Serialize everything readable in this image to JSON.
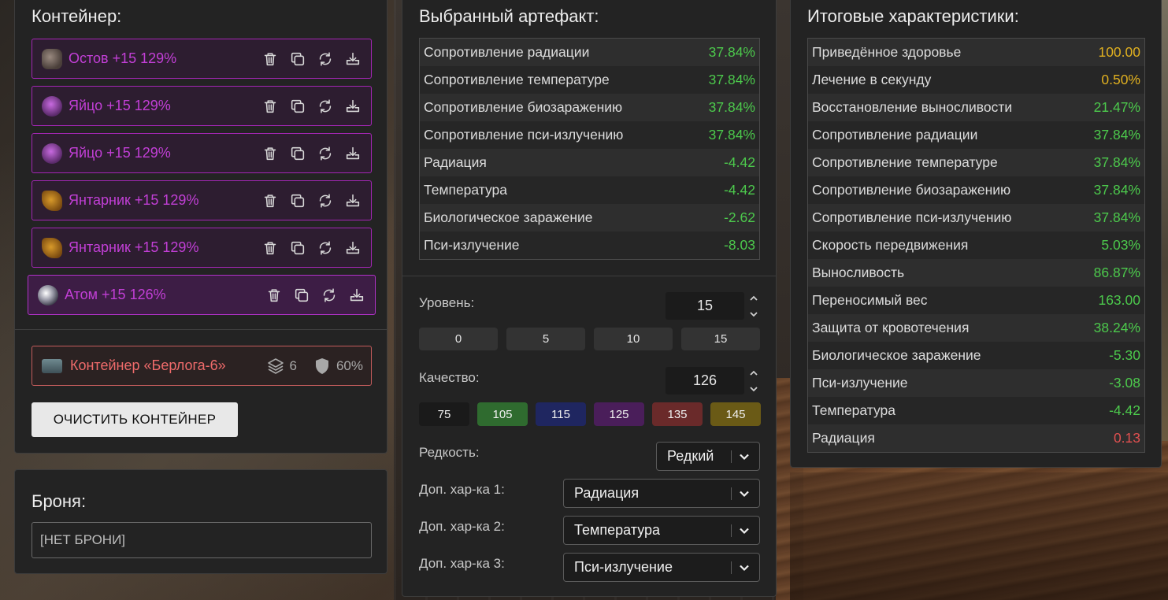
{
  "container_panel": {
    "title": "Контейнер:",
    "artifacts": [
      {
        "name": "Остов +15 129%",
        "thumb": "ostov"
      },
      {
        "name": "Яйцо +15 129%",
        "thumb": "egg"
      },
      {
        "name": "Яйцо +15 129%",
        "thumb": "egg"
      },
      {
        "name": "Янтарник +15 129%",
        "thumb": "amber"
      },
      {
        "name": "Янтарник +15 129%",
        "thumb": "amber"
      },
      {
        "name": "Атом +15 126%",
        "thumb": "atom",
        "selected": true
      }
    ],
    "container": {
      "name": "Контейнер «Берлога-6»",
      "slots": "6",
      "protection": "60%"
    },
    "clear_button": "ОЧИСТИТЬ КОНТЕЙНЕР"
  },
  "armor_panel": {
    "title": "Броня:",
    "value": "[НЕТ БРОНИ]"
  },
  "selected_panel": {
    "title": "Выбранный артефакт:",
    "stats": [
      {
        "label": "Сопротивление радиации",
        "value": "37.84%",
        "tone": "green"
      },
      {
        "label": "Сопротивление температуре",
        "value": "37.84%",
        "tone": "green"
      },
      {
        "label": "Сопротивление биозаражению",
        "value": "37.84%",
        "tone": "green"
      },
      {
        "label": "Сопротивление пси-излучению",
        "value": "37.84%",
        "tone": "green"
      },
      {
        "label": "Радиация",
        "value": "-4.42",
        "tone": "green"
      },
      {
        "label": "Температура",
        "value": "-4.42",
        "tone": "green"
      },
      {
        "label": "Биологическое заражение",
        "value": "-2.62",
        "tone": "green"
      },
      {
        "label": "Пси-излучение",
        "value": "-8.03",
        "tone": "green"
      }
    ],
    "level_label": "Уровень:",
    "level_value": "15",
    "level_presets": [
      "0",
      "5",
      "10",
      "15"
    ],
    "quality_label": "Качество:",
    "quality_value": "126",
    "quality_presets": [
      {
        "label": "75",
        "color": "#1a1a1a"
      },
      {
        "label": "105",
        "color": "#2f6b2f"
      },
      {
        "label": "115",
        "color": "#1f2660"
      },
      {
        "label": "125",
        "color": "#4a1e5a"
      },
      {
        "label": "135",
        "color": "#6a2a2a"
      },
      {
        "label": "145",
        "color": "#6a5a16"
      }
    ],
    "rarity_label": "Редкость:",
    "rarity_value": "Редкий",
    "extra1_label": "Доп. хар-ка 1:",
    "extra1_value": "Радиация",
    "extra2_label": "Доп. хар-ка 2:",
    "extra2_value": "Температура",
    "extra3_label": "Доп. хар-ка 3:",
    "extra3_value": "Пси-излучение"
  },
  "totals_panel": {
    "title": "Итоговые характеристики:",
    "stats": [
      {
        "label": "Приведённое здоровье",
        "value": "100.00",
        "tone": "yellow"
      },
      {
        "label": "Лечение в секунду",
        "value": "0.50%",
        "tone": "yellow"
      },
      {
        "label": "Восстановление выносливости",
        "value": "21.47%",
        "tone": "green"
      },
      {
        "label": "Сопротивление радиации",
        "value": "37.84%",
        "tone": "green"
      },
      {
        "label": "Сопротивление температуре",
        "value": "37.84%",
        "tone": "green"
      },
      {
        "label": "Сопротивление биозаражению",
        "value": "37.84%",
        "tone": "green"
      },
      {
        "label": "Сопротивление пси-излучению",
        "value": "37.84%",
        "tone": "green"
      },
      {
        "label": "Скорость передвижения",
        "value": "5.03%",
        "tone": "green"
      },
      {
        "label": "Выносливость",
        "value": "86.87%",
        "tone": "green"
      },
      {
        "label": "Переносимый вес",
        "value": "163.00",
        "tone": "green"
      },
      {
        "label": "Защита от кровотечения",
        "value": "38.24%",
        "tone": "green"
      },
      {
        "label": "Биологическое заражение",
        "value": "-5.30",
        "tone": "green"
      },
      {
        "label": "Пси-излучение",
        "value": "-3.08",
        "tone": "green"
      },
      {
        "label": "Температура",
        "value": "-4.42",
        "tone": "green"
      },
      {
        "label": "Радиация",
        "value": "0.13",
        "tone": "red"
      }
    ]
  }
}
